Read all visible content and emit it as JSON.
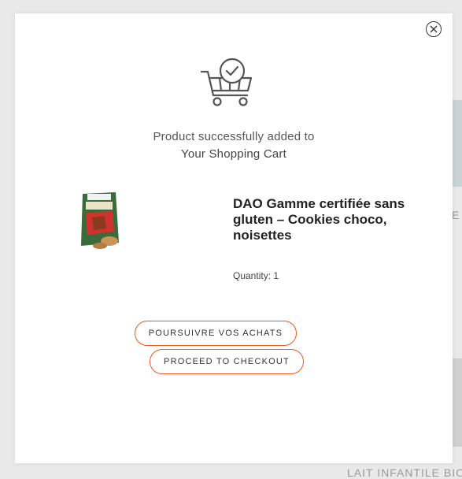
{
  "background": {
    "partial_label_1": "E",
    "partial_label_2": "LAIT INFANTILE BIO"
  },
  "modal": {
    "close_icon": "close-circle-icon",
    "cart_icon": "cart-check-icon",
    "success_line1": "Product successfully added to",
    "success_line2": "Your Shopping Cart",
    "product": {
      "name": "DAO Gamme certifiée sans gluten – Cookies choco, noisettes",
      "quantity_label": "Quantity: 1",
      "image_icon": "product-package-image"
    },
    "continue_label": "POURSUIVRE VOS ACHATS",
    "checkout_label": "PROCEED TO CHECKOUT"
  },
  "colors": {
    "accent": "#ef5a17",
    "icon": "#555555"
  }
}
